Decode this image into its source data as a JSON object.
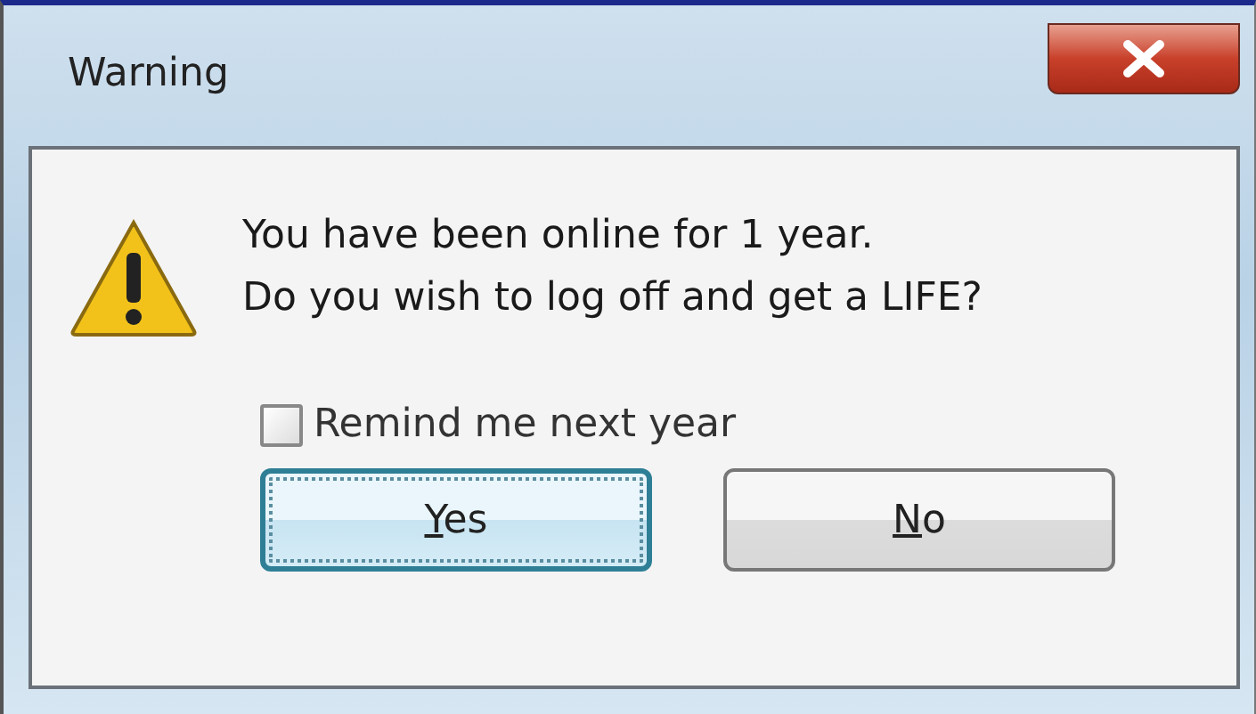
{
  "window": {
    "title": "Warning"
  },
  "message": [
    "You have been online for 1 year.",
    "Do you wish to log off and get a LIFE?"
  ],
  "checkbox": {
    "label": "Remind me next year",
    "checked": false
  },
  "buttons": [
    {
      "key": "Y",
      "rest": "es",
      "focused": true
    },
    {
      "key": "N",
      "rest": "o",
      "focused": false
    }
  ]
}
